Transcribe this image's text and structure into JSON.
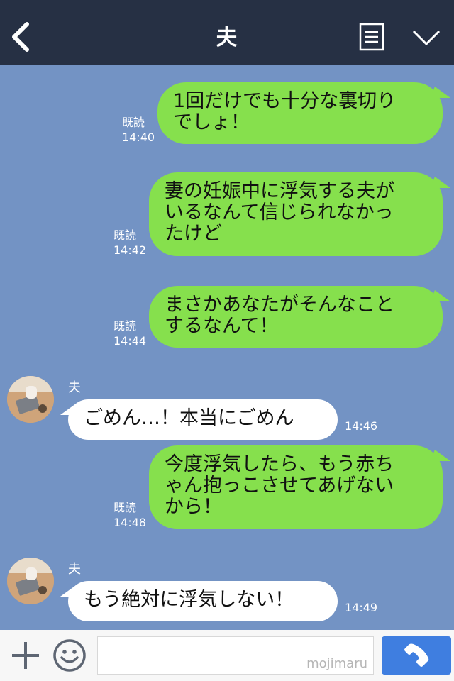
{
  "header": {
    "title": "夫"
  },
  "messages": [
    {
      "side": "right",
      "read": "既読",
      "time": "14:40",
      "text": "1回だけでも十分な裏切り\nでしょ！"
    },
    {
      "side": "right",
      "read": "既読",
      "time": "14:42",
      "text": "妻の妊娠中に浮気する夫が\nいるなんて信じられなかっ\nたけど"
    },
    {
      "side": "right",
      "read": "既読",
      "time": "14:44",
      "text": "まさかあなたがそんなこと\nするなんて！"
    },
    {
      "side": "left",
      "sender": "夫",
      "time": "14:46",
      "text": "ごめん…！本当にごめん"
    },
    {
      "side": "right",
      "read": "既読",
      "time": "14:48",
      "text": "今度浮気したら、もう赤ち\nゃん抱っこさせてあげない\nから！"
    },
    {
      "side": "left",
      "sender": "夫",
      "time": "14:49",
      "text": "もう絶対に浮気しない！"
    }
  ],
  "footer": {
    "input_value": "",
    "watermark": "mojimaru"
  },
  "colors": {
    "header": "#263044",
    "background": "#7393c4",
    "green_bubble": "#86e04d",
    "call_button": "#3f7ee0"
  }
}
